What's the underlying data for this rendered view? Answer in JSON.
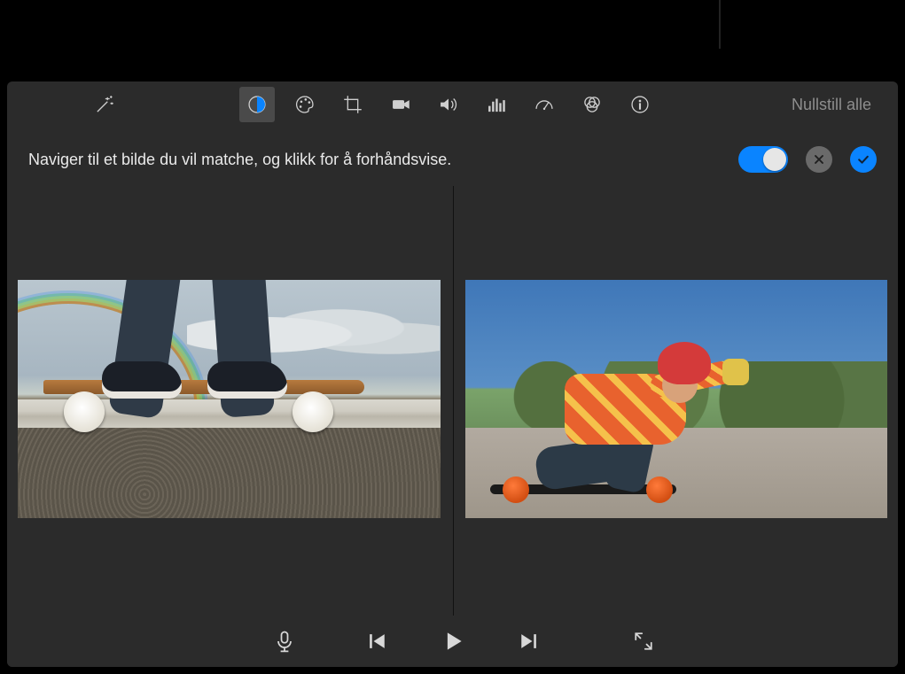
{
  "callout_label": "Nullstill alle",
  "toolbar": {
    "magic_wand": "magic-wand-icon",
    "items": [
      {
        "name": "color-balance-icon",
        "selected": true
      },
      {
        "name": "color-palette-icon",
        "selected": false
      },
      {
        "name": "crop-icon",
        "selected": false
      },
      {
        "name": "camera-icon",
        "selected": false
      },
      {
        "name": "volume-icon",
        "selected": false
      },
      {
        "name": "equalizer-icon",
        "selected": false
      },
      {
        "name": "speed-gauge-icon",
        "selected": false
      },
      {
        "name": "filters-icon",
        "selected": false
      },
      {
        "name": "info-icon",
        "selected": false
      }
    ],
    "reset_all_label": "Nullstill alle"
  },
  "instruction_text": "Naviger til et bilde du vil matche, og klikk for å forhåndsvise.",
  "adjust_toggle_on": true,
  "cancel_label": "Avbryt",
  "apply_label": "Bruk",
  "transport": {
    "mic": "microphone-icon",
    "prev": "previous-frame-icon",
    "play": "play-icon",
    "next": "next-frame-icon",
    "fullscreen": "fullscreen-icon"
  },
  "left_clip_alt": "Referansebilde – skateboard på asfalt",
  "right_clip_alt": "Gjeldende klipp – skateboarder med hjelm"
}
